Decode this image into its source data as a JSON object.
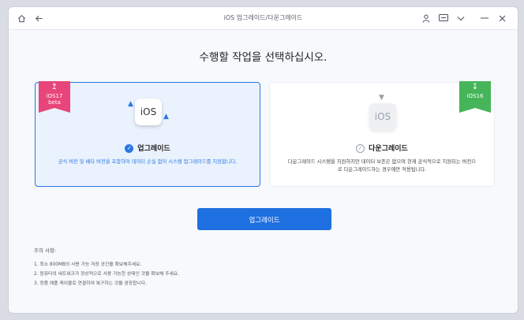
{
  "window": {
    "title": "iOS 업그레이드/다운그레이드"
  },
  "icons": {
    "home": "home-icon",
    "back": "back-arrow-icon",
    "user": "user-icon",
    "message": "message-icon",
    "dropdown": "chevron-down-icon",
    "minimize": "minimize-icon",
    "close": "close-icon"
  },
  "heading": "수행할 작업을 선택하십시오.",
  "options": {
    "upgrade": {
      "badge_line1": "iOS17",
      "badge_line2": "beta",
      "tile_text": "iOS",
      "title": "업그레이드",
      "description": "공식 버전 및 베타 버전을 포함하여 데이터 손실 없이 시스템 업그레이드를 지원합니다.",
      "selected": true
    },
    "downgrade": {
      "badge_line1": "iOS16",
      "tile_text": "iOS",
      "title": "다운그레이드",
      "description": "다운그레이드 시스템을 지원하지만 데이터 보존은 없으며 현재 공식적으로 지원되는 버전으로 다운그레이드하는 경우에만 적용됩니다.",
      "selected": false
    }
  },
  "action_button": "업그레이드",
  "notes": {
    "title": "주의 사항:",
    "items": [
      "1. 최소 800MB의 사용 가능 저장 공간을 확보해주세요.",
      "2. 컴퓨터의 네트워크가 정상적으로 사용 가능한 상태인 것을 확보해 주세요.",
      "3. 정품 애플 케이블로 연결하여 복구하는 것을 권장합니다."
    ]
  },
  "colors": {
    "accent": "#1e6fe0",
    "badge_pink": "#e8457a",
    "badge_green": "#46b55a"
  }
}
